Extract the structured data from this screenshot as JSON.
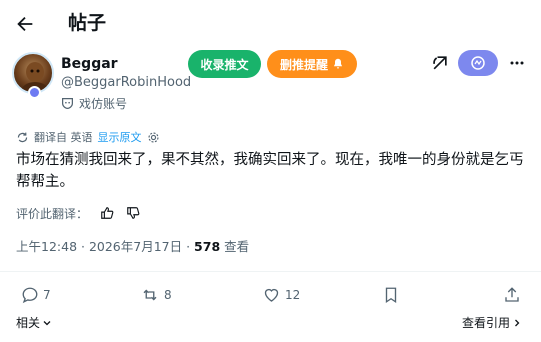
{
  "header": {
    "title": "帖子",
    "back_icon": "arrow-left-icon"
  },
  "author": {
    "name": "Beggar",
    "handle": "@BeggarRobinHood",
    "parody_label": "戏仿账号"
  },
  "buttons": {
    "collect_label": "收录推文",
    "push_label": "删推提醒"
  },
  "translation": {
    "translated_from": "翻译自 英语",
    "show_original": "显示原文"
  },
  "post": {
    "text": "市场在猜测我回来了，果不其然，我确实回来了。现在，我唯一的身份就是乞丐帮帮主。",
    "rate_label": "评价此翻译：",
    "time": "上午12:48 · 2026年7月17日 · ",
    "views_count": "578",
    "views_label": " 查看"
  },
  "actions": {
    "reply_count": "7",
    "repost_count": "8",
    "like_count": "12"
  },
  "footer": {
    "related_label": "相关",
    "quotes_label": "查看引用"
  },
  "colors": {
    "collect": "#19b36b",
    "push": "#ff8f1a",
    "ai": "#7d88ee",
    "link": "#1d9bf0"
  }
}
